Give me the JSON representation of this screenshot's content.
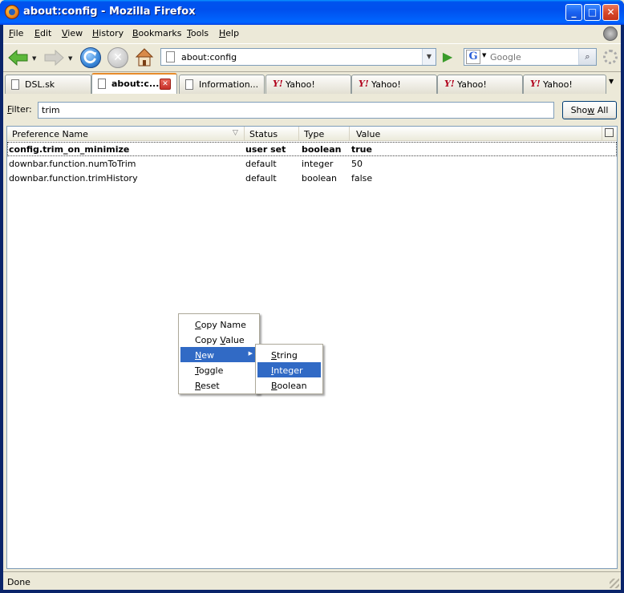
{
  "window": {
    "title": "about:config - Mozilla Firefox"
  },
  "menu": {
    "items": [
      "File",
      "Edit",
      "View",
      "History",
      "Bookmarks",
      "Tools",
      "Help"
    ]
  },
  "nav": {
    "url": "about:config",
    "search_placeholder": "Google",
    "search_engine_letter": "G"
  },
  "tabs": [
    {
      "label": "DSL.sk",
      "icon": "page"
    },
    {
      "label": "about:c...",
      "icon": "page",
      "active": true
    },
    {
      "label": "Information...",
      "icon": "page"
    },
    {
      "label": "Yahoo!",
      "icon": "yahoo"
    },
    {
      "label": "Yahoo!",
      "icon": "yahoo"
    },
    {
      "label": "Yahoo!",
      "icon": "yahoo"
    },
    {
      "label": "Yahoo!",
      "icon": "yahoo"
    }
  ],
  "filter": {
    "label": "Filter:",
    "value": "trim",
    "button": "Show All"
  },
  "table": {
    "columns": [
      "Preference Name",
      "Status",
      "Type",
      "Value"
    ],
    "rows": [
      {
        "name": "config.trim_on_minimize",
        "status": "user set",
        "type": "boolean",
        "value": "true"
      },
      {
        "name": "downbar.function.numToTrim",
        "status": "default",
        "type": "integer",
        "value": "50"
      },
      {
        "name": "downbar.function.trimHistory",
        "status": "default",
        "type": "boolean",
        "value": "false"
      }
    ]
  },
  "context_menu": {
    "items": [
      "Copy Name",
      "Copy Value",
      "New",
      "Toggle",
      "Reset"
    ],
    "highlighted": "New"
  },
  "submenu": {
    "items": [
      "String",
      "Integer",
      "Boolean"
    ],
    "highlighted": "Integer"
  },
  "status": {
    "text": "Done"
  },
  "colors": {
    "highlight": "#316ac5",
    "titlebar": "#0053ee",
    "active_tab_accent": "#e68b2c"
  }
}
